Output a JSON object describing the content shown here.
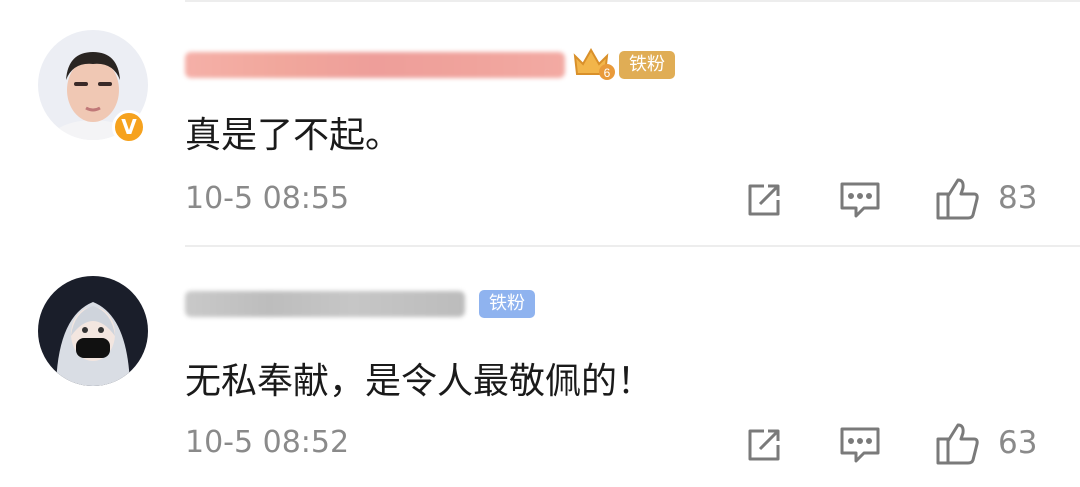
{
  "comments": [
    {
      "text": "真是了不起。",
      "time": "10-5 08:55",
      "badge": "铁粉",
      "badge_color": "#e0ad55",
      "crown_level": "6",
      "verified_mark": "V",
      "likes": "83",
      "icons": {
        "share": "share-icon",
        "reply": "comment-icon",
        "like": "thumbs-up-icon"
      }
    },
    {
      "text": "无私奉献，是令人最敬佩的！",
      "time": "10-5 08:52",
      "badge": "铁粉",
      "badge_color": "#8fb3ef",
      "likes": "63",
      "icons": {
        "share": "share-icon",
        "reply": "comment-icon",
        "like": "thumbs-up-icon"
      }
    }
  ],
  "colors": {
    "verified": "#f6a21e",
    "divider": "#ededed",
    "meta_text": "#8a8a8a"
  }
}
